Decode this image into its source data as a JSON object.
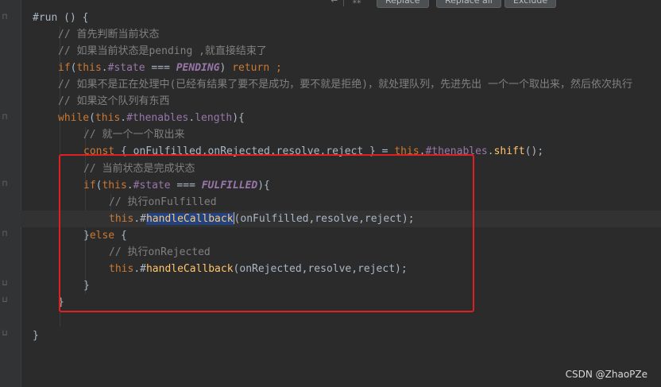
{
  "toolbar": {
    "replace_label": "Replace",
    "replace_all_label": "Replace all",
    "exclude_label": "Exclude"
  },
  "code_lines": [
    "#run () {",
    "// 首先判断当前状态",
    "// 如果当前状态是pending ,就直接结束了",
    "if(this.#state === PENDING) return ;",
    "// 如果不是正在处理中(已经有结果了要不是成功，要不就是拒绝)，就处理队列，先进先出 一个一个取出来，然后依次执行",
    "// 如果这个队列有东西",
    "while(this.#thenables.length){",
    "// 就一个一个取出来",
    "const { onFulfilled,onRejected,resolve,reject } = this.#thenables.shift();",
    "// 当前状态是完成状态",
    "if(this.#state === FULFILLED){",
    "// 执行onFulfilled",
    "this.#handleCallback(onFulfilled,resolve,reject);",
    "}else {",
    "// 执行onRejected",
    "this.#handleCallback(onRejected,resolve,reject);",
    "}",
    "}",
    "}"
  ],
  "tokens": {
    "run": "#run () {",
    "if_kw": "if",
    "this_kw": "this",
    "state_field": "#state",
    "eq": " === ",
    "pending_const": "PENDING",
    "return_kw": "return",
    "while_kw": "while",
    "thenables_field": "#thenables",
    "length_field": "length",
    "const_kw": "const",
    "shift_fn": "shift",
    "fulfilled_const": "FULFILLED",
    "handle_fn": "handleCallback",
    "else_kw": "else",
    "args_fulfilled": "(onFulfilled,resolve,reject);",
    "args_rejected": "(onRejected,resolve,reject);",
    "destructure": " { onFulfilled,onRejected,resolve,reject } = "
  },
  "watermark": "CSDN @ZhaoPZe"
}
